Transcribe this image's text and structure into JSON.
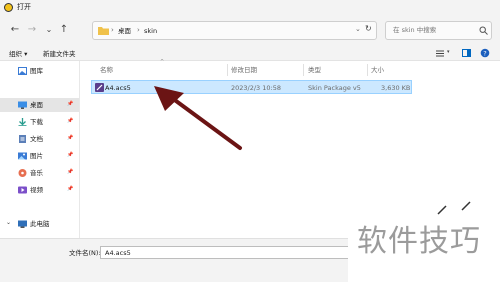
{
  "window": {
    "title": "打开"
  },
  "nav": {
    "back": "←",
    "forward": "→",
    "dropdown": "⌄",
    "up": "↑"
  },
  "address": {
    "crumbs": [
      "桌面",
      "skin"
    ],
    "sep": "›"
  },
  "search": {
    "placeholder": "在 skin 中搜索"
  },
  "toolbar": {
    "organize": "组织 ▾",
    "new_folder": "新建文件夹"
  },
  "sidebar": {
    "items": [
      {
        "label": "图库"
      },
      {
        "label": "桌面"
      },
      {
        "label": "下载"
      },
      {
        "label": "文档"
      },
      {
        "label": "图片"
      },
      {
        "label": "音乐"
      },
      {
        "label": "视频"
      },
      {
        "label": "此电脑"
      }
    ]
  },
  "columns": {
    "name": "名称",
    "modified": "修改日期",
    "type": "类型",
    "size": "大小"
  },
  "files": [
    {
      "name": "A4.acs5",
      "modified": "2023/2/3 10:58",
      "type": "Skin Package v5",
      "size": "3,630 KB"
    }
  ],
  "footer": {
    "filename_label": "文件名(N):",
    "filename_value": "A4.acs5"
  },
  "watermark": {
    "text": "软件技巧"
  },
  "colors": {
    "accent": "#0067c0",
    "selection": "#cce8ff",
    "arrow": "#6b1414"
  }
}
